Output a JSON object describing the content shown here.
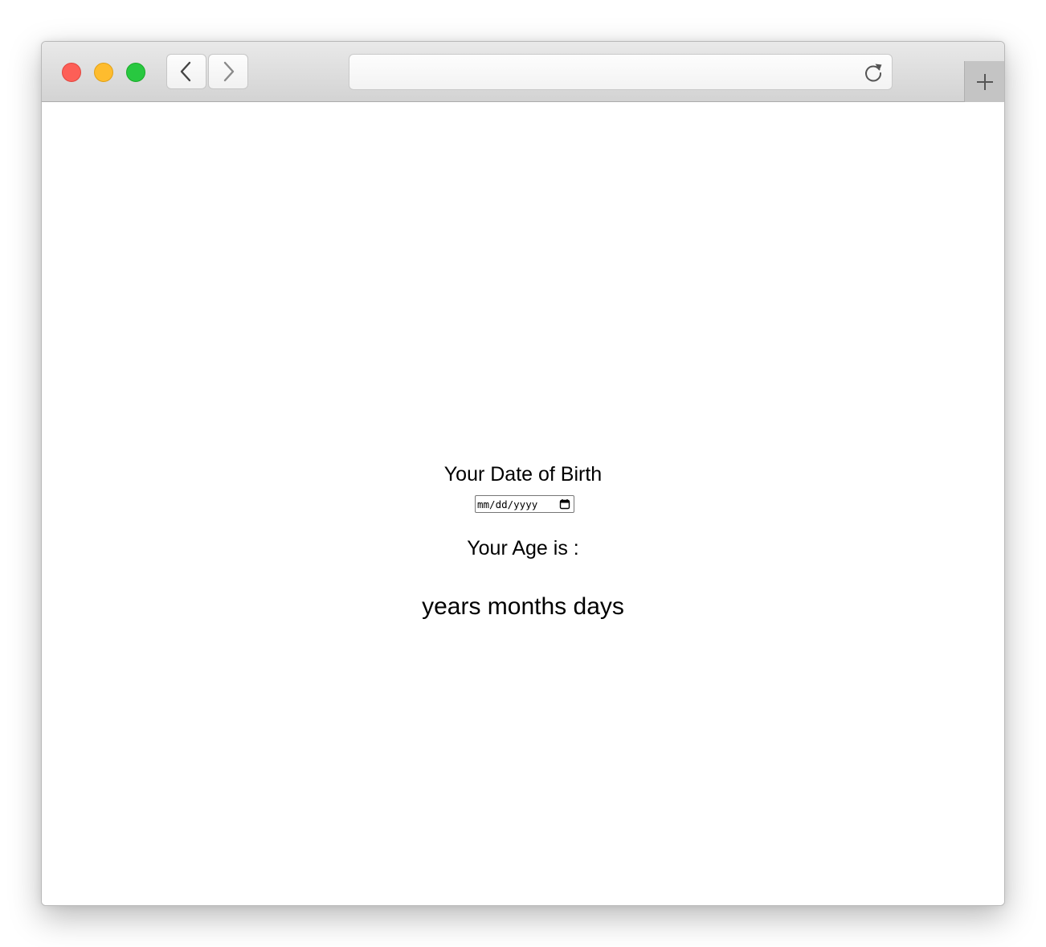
{
  "browser": {
    "url": "",
    "icons": {
      "back": "chevron-left-icon",
      "forward": "chevron-right-icon",
      "reload": "reload-icon",
      "new_tab": "plus-icon"
    },
    "colors": {
      "close": "#fd5f57",
      "minimize": "#febc2e",
      "zoom": "#28c840"
    }
  },
  "page": {
    "dob_label": "Your Date of Birth",
    "date_input": {
      "placeholder": "mm/dd/yyyy",
      "value": ""
    },
    "age_label": "Your Age is :",
    "age_result": "years months days"
  }
}
